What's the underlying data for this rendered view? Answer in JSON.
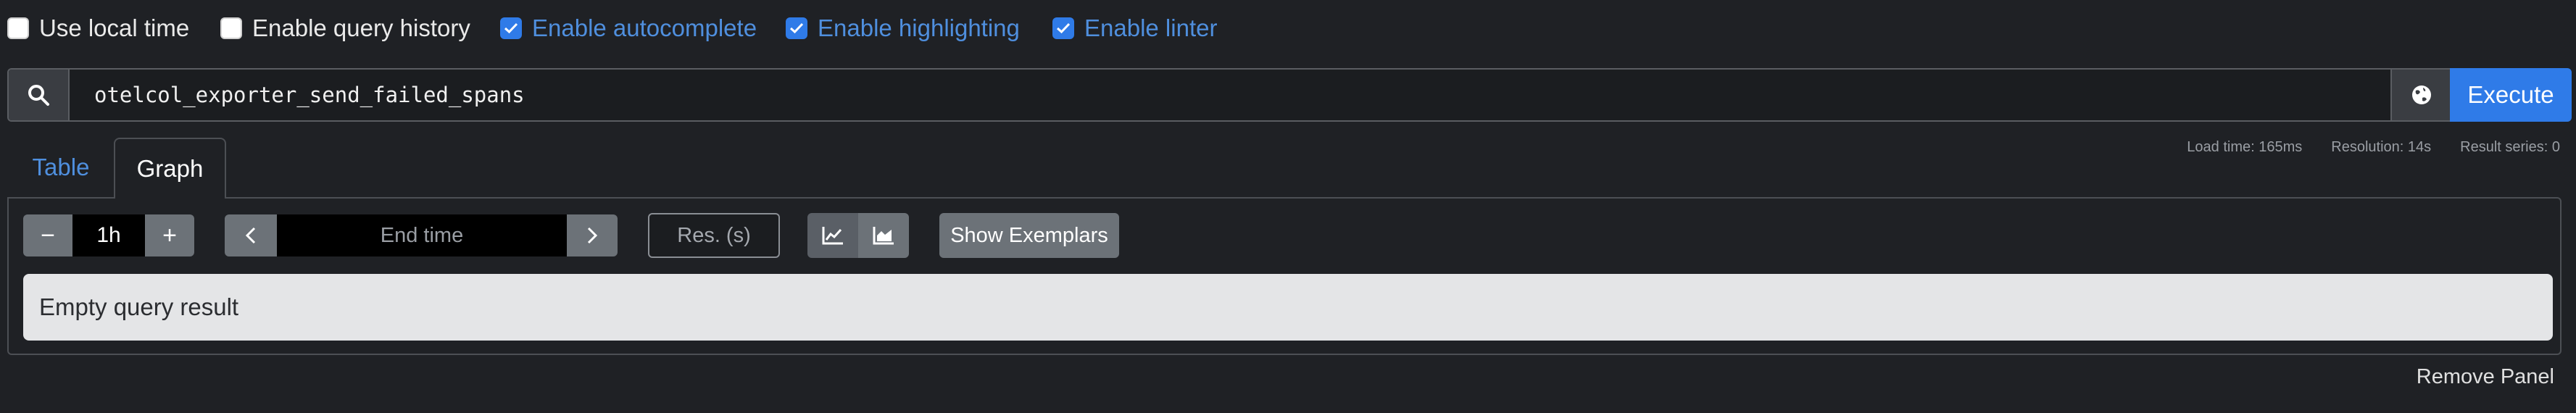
{
  "options": [
    {
      "label": "Use local time",
      "checked": false
    },
    {
      "label": "Enable query history",
      "checked": false
    },
    {
      "label": "Enable autocomplete",
      "checked": true
    },
    {
      "label": "Enable highlighting",
      "checked": true
    },
    {
      "label": "Enable linter",
      "checked": true
    }
  ],
  "query": {
    "value": "otelcol_exporter_send_failed_spans",
    "execute_label": "Execute",
    "search_icon": "search-icon",
    "globe_icon": "globe-icon"
  },
  "tabs": {
    "table": "Table",
    "graph": "Graph"
  },
  "stats": {
    "load_time": "Load time: 165ms",
    "resolution": "Resolution: 14s",
    "result_series": "Result series: 0"
  },
  "controls": {
    "minus": "−",
    "range": "1h",
    "plus": "+",
    "end_time_placeholder": "End time",
    "res_placeholder": "Res. (s)",
    "show_exemplars": "Show Exemplars"
  },
  "result": {
    "message": "Empty query result"
  },
  "footer": {
    "remove_panel": "Remove Panel"
  },
  "colors": {
    "accent": "#2f7be8",
    "background": "#1f2125"
  }
}
